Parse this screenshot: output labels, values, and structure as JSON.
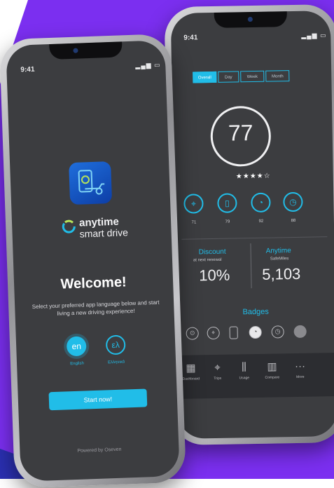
{
  "welcome_screen": {
    "status_time": "9:41",
    "brand_line1": "anytime",
    "brand_line2": "smart drive",
    "title": "Welcome!",
    "description": "Select your preferred app language below and start living a new driving experience!",
    "language_options": [
      {
        "code": "en",
        "label": "English",
        "selected": true
      },
      {
        "code": "ελ",
        "label": "Ελληνικά",
        "selected": false
      }
    ],
    "start_button": "Start now!",
    "footer": "Powered by Oseven"
  },
  "dashboard_screen": {
    "status_time": "9:41",
    "period_tabs": [
      "Overall",
      "Day",
      "Week",
      "Month"
    ],
    "active_tab": "Overall",
    "score": "77",
    "stars_rating": "★★★★☆",
    "metrics": [
      {
        "icon": "location-pin-icon",
        "value": "71"
      },
      {
        "icon": "phone-icon",
        "value": "79"
      },
      {
        "icon": "speed-icon",
        "value": "92"
      },
      {
        "icon": "gauge-icon",
        "value": "88"
      }
    ],
    "discount_title": "Discount",
    "discount_subtitle": "at next renewal",
    "discount_value": "10%",
    "safemiles_title": "Anytime",
    "safemiles_subtitle": "SafeMiles",
    "safemiles_value": "5,103",
    "badges_title": "Badges",
    "badges": [
      "steering-wheel-icon",
      "location-pin-icon",
      "phone-icon",
      "speed-icon",
      "gauge-icon",
      "clock-icon"
    ],
    "nav_items": [
      {
        "label": "Dashboard",
        "icon": "grid-icon",
        "active": true
      },
      {
        "label": "Trips",
        "icon": "location-pin-icon",
        "active": false
      },
      {
        "label": "Usage",
        "icon": "road-icon",
        "active": false
      },
      {
        "label": "Compare",
        "icon": "bar-chart-icon",
        "active": false
      },
      {
        "label": "More",
        "icon": "more-icon",
        "active": false
      }
    ]
  },
  "colors": {
    "background_purple": "#7b2ff0",
    "accent_cyan": "#21bde8",
    "screen_dark": "#3c3d40",
    "app_icon_blue": "#1f5fd6"
  }
}
